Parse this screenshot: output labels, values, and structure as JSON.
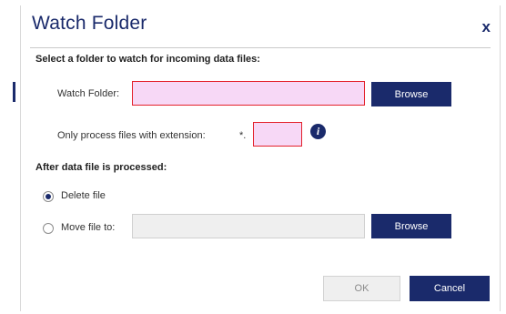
{
  "dialog": {
    "title": "Watch Folder",
    "close_label": "x"
  },
  "watch_section": {
    "heading": "Select a folder to watch for incoming data files:",
    "folder_label": "Watch Folder:",
    "folder_value": "",
    "browse_label": "Browse",
    "extension_label": "Only process files with extension:",
    "extension_prefix": "*.",
    "extension_value": "",
    "info_icon": "i"
  },
  "after_section": {
    "heading": "After data file is processed:",
    "options": [
      {
        "label": "Delete file",
        "selected": true
      },
      {
        "label": "Move file to:",
        "selected": false
      }
    ],
    "move_path_value": "",
    "browse_label": "Browse"
  },
  "footer": {
    "ok_label": "OK",
    "cancel_label": "Cancel"
  },
  "colors": {
    "accent": "#1a2a6b",
    "invalid_fill": "#f7d8f6",
    "invalid_border": "#e3212b",
    "disabled_fill": "#efefef"
  }
}
